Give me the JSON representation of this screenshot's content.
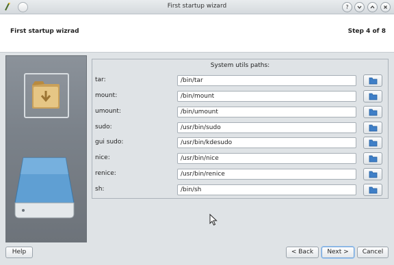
{
  "window": {
    "title": "First startup wizard",
    "controls": [
      "help-icon",
      "chevron-down-icon",
      "chevron-up-icon",
      "close-icon"
    ]
  },
  "header": {
    "title": "First startup wizrad",
    "step": "Step 4 of 8"
  },
  "panel": {
    "title": "System utils paths:",
    "rows": [
      {
        "label": "tar:",
        "value": "/bin/tar"
      },
      {
        "label": "mount:",
        "value": "/bin/mount"
      },
      {
        "label": "umount:",
        "value": "/bin/umount"
      },
      {
        "label": "sudo:",
        "value": "/usr/bin/sudo"
      },
      {
        "label": "gui sudo:",
        "value": "/usr/bin/kdesudo"
      },
      {
        "label": "nice:",
        "value": "/usr/bin/nice"
      },
      {
        "label": "renice:",
        "value": "/usr/bin/renice"
      },
      {
        "label": "sh:",
        "value": "/bin/sh"
      }
    ]
  },
  "footer": {
    "help": "Help",
    "back": "< Back",
    "next": "Next >",
    "cancel": "Cancel"
  }
}
